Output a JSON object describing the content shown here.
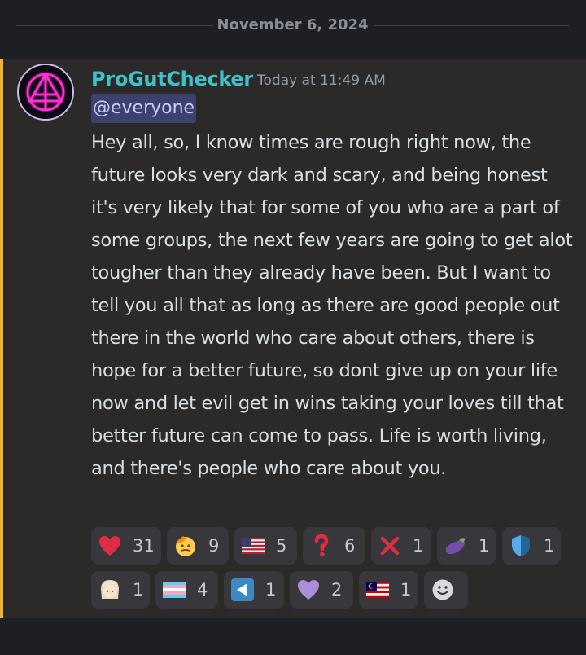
{
  "divider": {
    "date": "November 6, 2024"
  },
  "message": {
    "username": "ProGutChecker",
    "timestamp": "Today at 11:49 AM",
    "mention": "@everyone",
    "content": "Hey all, so, I know times are rough right now, the future looks very dark and scary, and being honest it's very likely that for some of you who are a part of some groups, the next few years are going to get alot tougher than they already have been. But I want to tell you all that as long as there are good people out there in the world who care about others, there is hope for a better future, so dont give up on your life now and let evil get in wins taking your loves till that better future can come to pass. Life is worth living, and there's people who care about you."
  },
  "reactions": [
    {
      "icon": "red-heart-icon",
      "count": "31"
    },
    {
      "icon": "saluting-face-icon",
      "count": "9"
    },
    {
      "icon": "us-flag-icon",
      "count": "5"
    },
    {
      "icon": "red-question-mark-icon",
      "count": "6"
    },
    {
      "icon": "cross-mark-icon",
      "count": "1"
    },
    {
      "icon": "eggplant-icon",
      "count": "1"
    },
    {
      "icon": "shield-icon",
      "count": "1"
    },
    {
      "icon": "anime-character-icon",
      "count": "1"
    },
    {
      "icon": "transgender-flag-icon",
      "count": "4"
    },
    {
      "icon": "reverse-button-icon",
      "count": "1"
    },
    {
      "icon": "purple-heart-icon",
      "count": "2"
    },
    {
      "icon": "malaysia-flag-icon",
      "count": "1"
    }
  ],
  "add_reaction": {
    "icon": "add-reaction-smiley-icon"
  }
}
